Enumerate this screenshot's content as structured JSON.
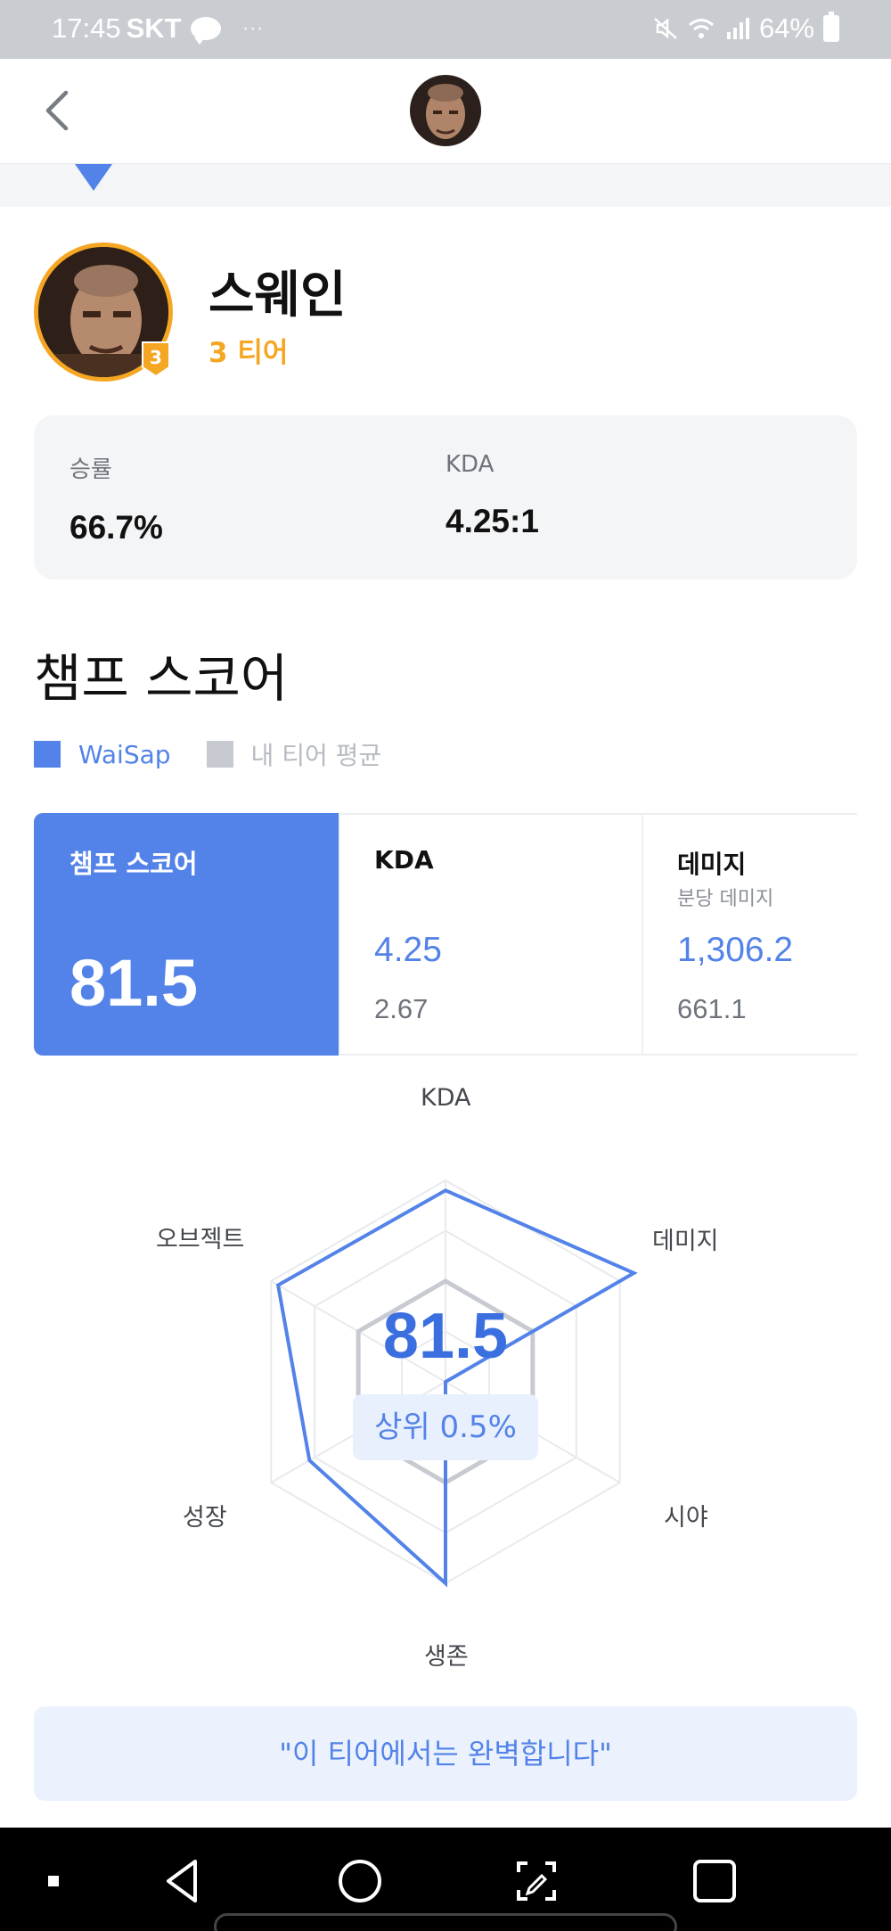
{
  "status_bar": {
    "time": "17:45",
    "carrier": "SKT",
    "dots": "···",
    "battery": "64%"
  },
  "champion": {
    "name": "스웨인",
    "tier_text": "3 티어",
    "tier_badge": "3"
  },
  "summary": {
    "win_rate_label": "승률",
    "win_rate_value": "66.7%",
    "kda_label": "KDA",
    "kda_value": "4.25:1"
  },
  "section_title": "챔프 스코어",
  "legend": {
    "mine": "WaiSap",
    "average": "내 티어 평균"
  },
  "score_cards": {
    "main_title": "챔프 스코어",
    "main_value": "81.5",
    "cards": [
      {
        "title": "KDA",
        "subtitle": "",
        "mine": "4.25",
        "avg": "2.67"
      },
      {
        "title": "데미지",
        "subtitle": "분당 데미지",
        "mine": "1,306.2",
        "avg": "661.1"
      }
    ]
  },
  "radar": {
    "axes": [
      "KDA",
      "데미지",
      "시야",
      "생존",
      "성장",
      "오브젝트"
    ],
    "score": "81.5",
    "rank": "상위 0.5%"
  },
  "comment": "\"이 티어에서는 완벽합니다\"",
  "colors": {
    "accent": "#5383e8",
    "tier": "#f5a623",
    "average": "#c7cbd1"
  },
  "chart_data": {
    "type": "radar",
    "categories": [
      "KDA",
      "데미지",
      "시야",
      "생존",
      "성장",
      "오브젝트"
    ],
    "series": [
      {
        "name": "WaiSap",
        "values": [
          0.95,
          1.08,
          0.0,
          1.0,
          0.78,
          0.96
        ]
      },
      {
        "name": "내 티어 평균",
        "values": [
          0.5,
          0.5,
          0.5,
          0.5,
          0.5,
          0.5
        ]
      }
    ],
    "ylim": [
      0,
      1
    ]
  }
}
